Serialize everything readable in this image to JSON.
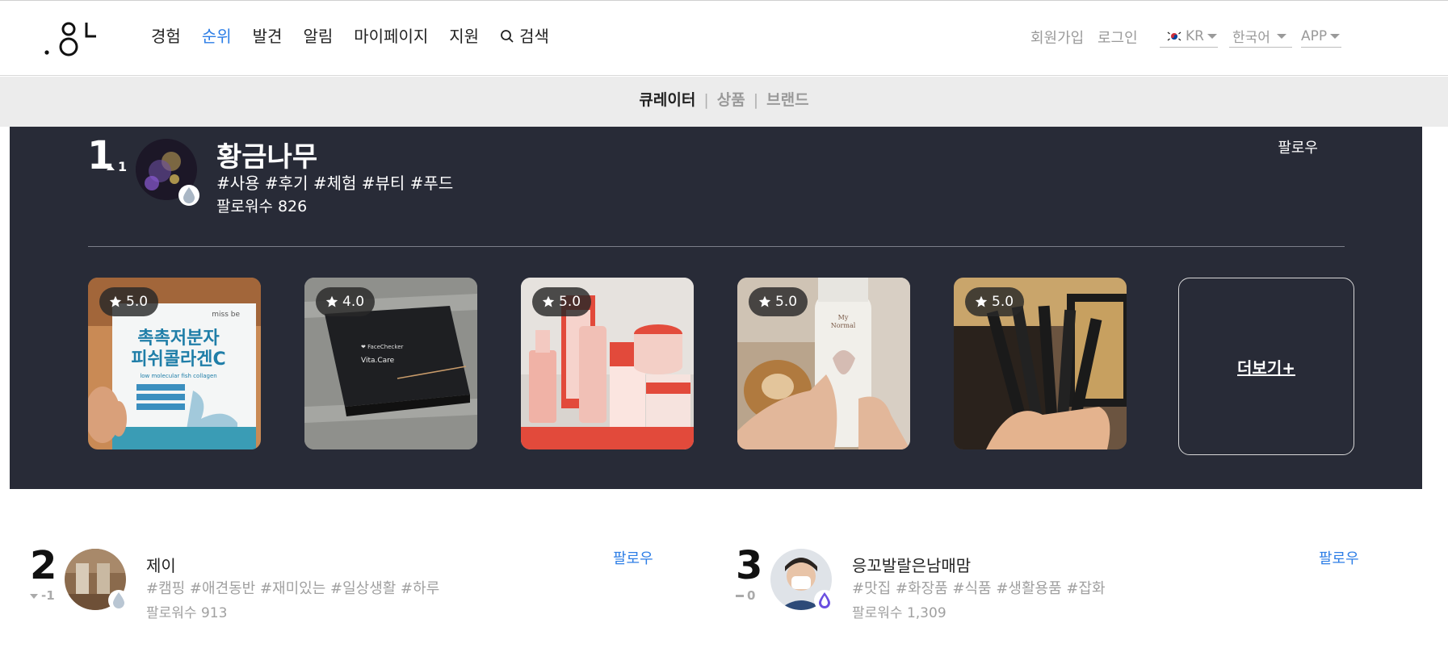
{
  "header": {
    "nav": [
      {
        "label": "경험",
        "active": false
      },
      {
        "label": "순위",
        "active": true
      },
      {
        "label": "발견",
        "active": false
      },
      {
        "label": "알림",
        "active": false
      },
      {
        "label": "마이페이지",
        "active": false
      },
      {
        "label": "지원",
        "active": false
      }
    ],
    "search_label": "검색",
    "signup_label": "회원가입",
    "login_label": "로그인",
    "region_select": "KR",
    "language_select": "한국어",
    "app_select": "APP",
    "accent_color": "#2d7ee6"
  },
  "subtabs": [
    {
      "label": "큐레이터",
      "active": true
    },
    {
      "label": "상품",
      "active": false
    },
    {
      "label": "브랜드",
      "active": false
    }
  ],
  "featured": {
    "rank": "1",
    "rank_change": "1",
    "name": "황금나무",
    "tags": "#사용 #후기 #체험 #뷰티 #푸드",
    "followers": "팔로워수 826",
    "follow_label": "팔로우",
    "background_color": "#282b37",
    "reviews": [
      {
        "rating": "5.0"
      },
      {
        "rating": "4.0"
      },
      {
        "rating": "5.0"
      },
      {
        "rating": "5.0"
      },
      {
        "rating": "5.0"
      }
    ],
    "product_text": {
      "brand": "miss be",
      "title_line1": "촉촉저분자",
      "title_line2": "피쉬콜라겐C",
      "subtitle": "low molecular fish collagen",
      "box_brand": "Vita.Care",
      "bottle_line1": "My",
      "bottle_line2": "Normal"
    },
    "more_label": "더보기+"
  },
  "list": [
    {
      "rank": "2",
      "rank_change": "-1",
      "name": "제이",
      "tags": "#캠핑 #애견동반 #재미있는 #일상생활 #하루",
      "followers": "팔로워수 913",
      "follow_label": "팔로우"
    },
    {
      "rank": "3",
      "rank_change": "0",
      "name": "응꼬발랄은남매맘",
      "tags": "#맛집 #화장품 #식품 #생활용품 #잡화",
      "followers": "팔로워수 1,309",
      "follow_label": "팔로우"
    }
  ]
}
